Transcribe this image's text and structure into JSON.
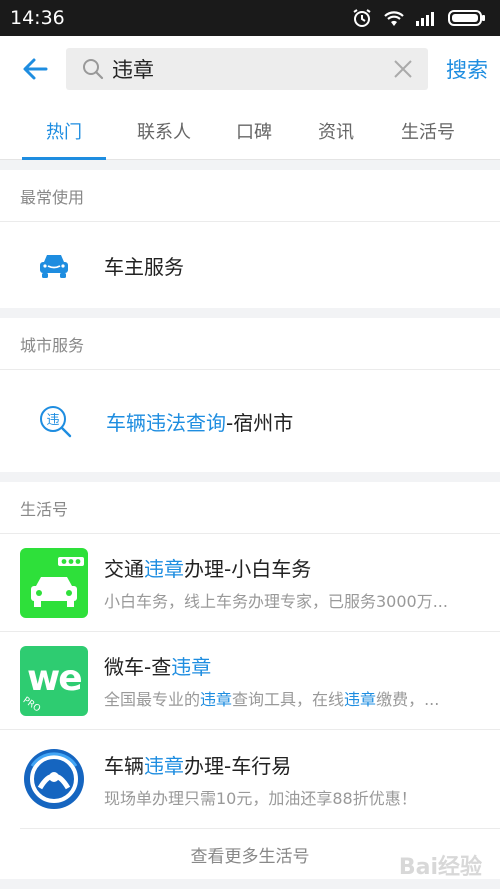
{
  "status": {
    "time": "14:36"
  },
  "search": {
    "query": "违章",
    "button_label": "搜索"
  },
  "tabs": [
    {
      "label": "热门",
      "active": true
    },
    {
      "label": "联系人"
    },
    {
      "label": "口碑"
    },
    {
      "label": "资讯"
    },
    {
      "label": "生活号"
    }
  ],
  "frequent": {
    "title": "最常使用",
    "item_label": "车主服务"
  },
  "city": {
    "title": "城市服务",
    "item_highlight": "车辆违法查询",
    "item_suffix": "-宿州市"
  },
  "life": {
    "title": "生活号",
    "items": [
      {
        "title_pre": "交通",
        "title_hl": "违章",
        "title_post": "办理-小白车务",
        "desc": "小白车务，线上车务办理专家，已服务3000万..."
      },
      {
        "title_pre": "微车-查",
        "title_hl": "违章",
        "title_post": "",
        "desc_pre": "全国最专业的",
        "desc_hl1": "违章",
        "desc_mid": "查询工具，在线",
        "desc_hl2": "违章",
        "desc_post": "缴费，...",
        "icon_text": "we",
        "icon_sub": "PRO"
      },
      {
        "title_pre": "车辆",
        "title_hl": "违章",
        "title_post": "办理-车行易",
        "desc": "现场单办理只需10元，加油还享88折优惠！"
      }
    ],
    "more_label": "查看更多生活号"
  },
  "watermark": "Bai经验",
  "colors": {
    "accent": "#1e8de0",
    "green_icon": "#2ee03a",
    "wecar_green": "#2ecc71"
  }
}
